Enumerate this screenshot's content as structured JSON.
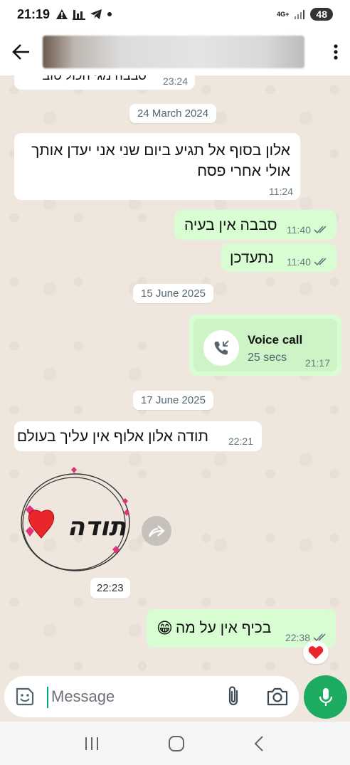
{
  "status_bar": {
    "time": "21:19",
    "network_type": "4G+",
    "battery": "48",
    "icons": [
      "alert-icon",
      "stats-icon",
      "telegram-icon",
      "dot-icon",
      "signal-icon",
      "battery-icon"
    ]
  },
  "header": {
    "back_icon": "arrow-left-icon",
    "contact_name": "",
    "menu_icon": "more-vert-icon"
  },
  "chat": {
    "partial_top": {
      "text": "סבבה מגי הכול טוב",
      "time": "23:24"
    },
    "date_1": "24 March 2024",
    "msg_1": {
      "lines": [
        "אלון בסוף אל תגיע ביום שני אני יעדן אותך",
        "אולי אחרי פסח"
      ],
      "time": "11:24"
    },
    "msg_2": {
      "text": "סבבה אין בעיה",
      "time": "11:40"
    },
    "msg_3": {
      "text": "נתעדכן",
      "time": "11:40"
    },
    "date_2": "15 June 2025",
    "voice_call": {
      "title": "Voice call",
      "duration": "25 secs",
      "time": "21:17"
    },
    "date_3": "17 June 2025",
    "msg_4": {
      "text": "תודה אלון אלוף אין עליך בעולם",
      "time": "22:21"
    },
    "sticker": {
      "text": "תודה",
      "time": "22:23"
    },
    "msg_5": {
      "text": "בכיף אין על מה",
      "emoji": "😁",
      "time": "22:38"
    },
    "reaction": "❤️"
  },
  "composer": {
    "placeholder": "Message",
    "value": ""
  },
  "colors": {
    "accent": "#1daa61",
    "outgoing_bubble": "#d9fdd3",
    "incoming_bubble": "#ffffff",
    "chat_background": "#efe7de"
  }
}
